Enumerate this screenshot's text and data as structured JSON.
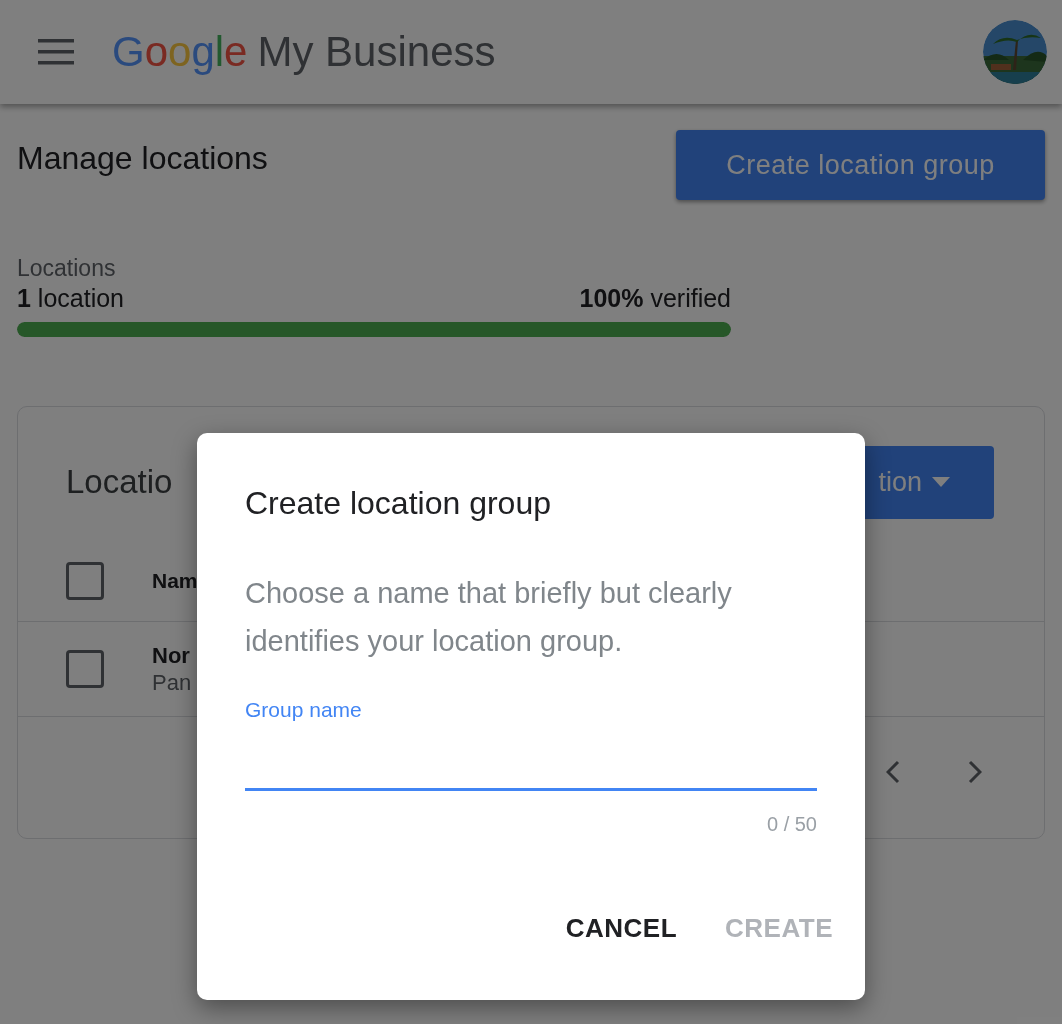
{
  "header": {
    "logo_letters": [
      {
        "char": "G",
        "color": "#2a4a7e"
      },
      {
        "char": "o",
        "color": "#7a2a22"
      },
      {
        "char": "o",
        "color": "#7e6420"
      },
      {
        "char": "g",
        "color": "#2a4a7e"
      },
      {
        "char": "l",
        "color": "#22592f"
      },
      {
        "char": "e",
        "color": "#7a2a22"
      }
    ],
    "product": "My Business"
  },
  "page": {
    "title": "Manage locations",
    "primary_button": "Create location group"
  },
  "summary": {
    "label": "Locations",
    "count": "**1** location",
    "verified": "**100%** verified",
    "level": 1
  },
  "card": {
    "title": "Locatio",
    "action_button": "tion",
    "header_row": {
      "checked": false,
      "name": "Nam"
    },
    "rows": [
      {
        "checked": false,
        "name": "Nor",
        "address": "Pan"
      }
    ]
  },
  "dialog": {
    "title": "Create location group",
    "description": "Choose a name that briefly but clearly identifies your location group.",
    "field": {
      "label": "Group name",
      "focused": true,
      "counter": "0 / 50"
    },
    "buttons": [
      {
        "label": "CANCEL",
        "disabled": false
      },
      {
        "label": "CREATE",
        "disabled": true
      }
    ]
  }
}
